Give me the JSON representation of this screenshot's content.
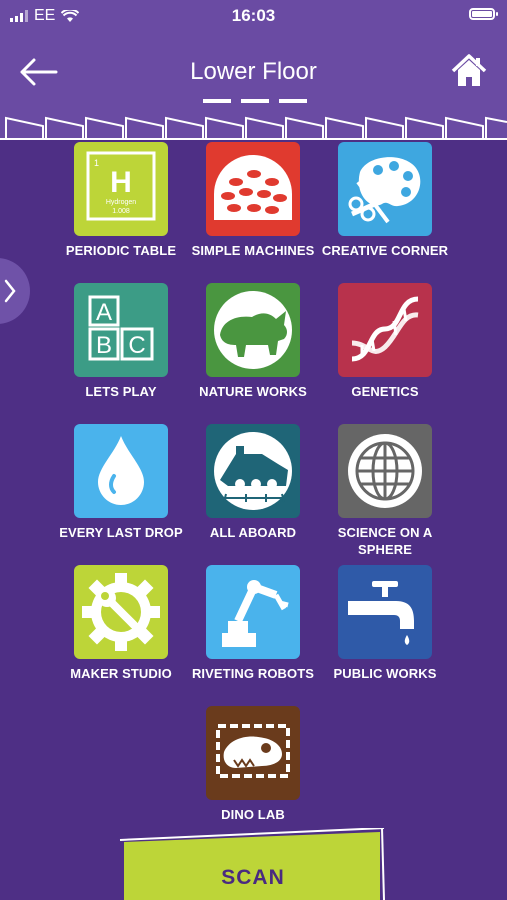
{
  "status": {
    "carrier": "EE",
    "time": "16:03"
  },
  "header": {
    "title": "Lower Floor"
  },
  "tiles": [
    {
      "label": "PERIODIC TABLE",
      "icon": "periodic-table-icon",
      "color": "#bdd538",
      "element_symbol": "H",
      "element_number": "1",
      "element_name": "Hydrogen",
      "element_mass": "1.008"
    },
    {
      "label": "SIMPLE MACHINES",
      "icon": "gears-dome-icon",
      "color": "#e03a2f"
    },
    {
      "label": "CREATIVE CORNER",
      "icon": "palette-icon",
      "color": "#3ea7e0"
    },
    {
      "label": "LETS PLAY",
      "icon": "abc-blocks-icon",
      "color": "#3c9c86",
      "blocks": [
        "A",
        "B",
        "C"
      ]
    },
    {
      "label": "NATURE WORKS",
      "icon": "rhino-icon",
      "color": "#4a9640"
    },
    {
      "label": "GENETICS",
      "icon": "dna-icon",
      "color": "#b8324c"
    },
    {
      "label": "EVERY LAST DROP",
      "icon": "water-drop-icon",
      "color": "#4ab3ec"
    },
    {
      "label": "ALL ABOARD",
      "icon": "train-icon",
      "color": "#1f6577"
    },
    {
      "label": "SCIENCE ON A SPHERE",
      "icon": "globe-icon",
      "color": "#666666"
    },
    {
      "label": "MAKER STUDIO",
      "icon": "gear-wrench-icon",
      "color": "#bdd538"
    },
    {
      "label": "RIVETING ROBOTS",
      "icon": "robot-arm-icon",
      "color": "#4ab3ec"
    },
    {
      "label": "PUBLIC WORKS",
      "icon": "tap-icon",
      "color": "#2f5aa8"
    },
    {
      "label": "DINO LAB",
      "icon": "dinosaur-skull-icon",
      "color": "#6a3b1c"
    }
  ],
  "scan": {
    "label": "SCAN",
    "color": "#bdd538"
  },
  "colors": {
    "background": "#4e2f85",
    "header": "#6a4ba3"
  }
}
